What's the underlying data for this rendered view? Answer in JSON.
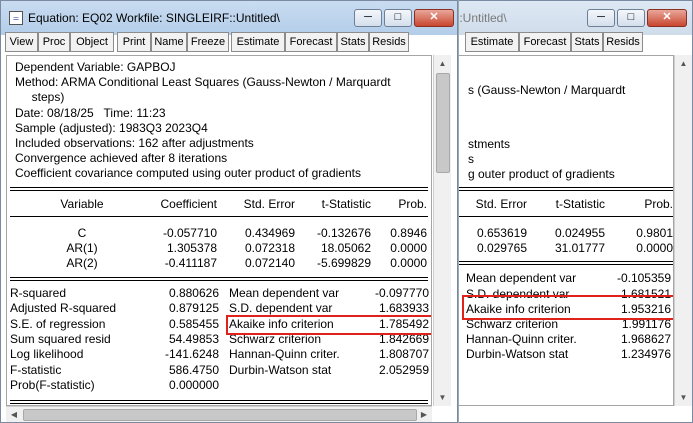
{
  "colors": {
    "highlight": "#e0221b",
    "titlebar": "#b9d1ea"
  },
  "window_a": {
    "title": "Equation: EQ02   Workfile: SINGLEIRF::Untitled\\",
    "toolbar": [
      "View",
      "Proc",
      "Object",
      "Print",
      "Name",
      "Freeze",
      "Estimate",
      "Forecast",
      "Stats",
      "Resids"
    ],
    "header_lines": [
      "Dependent Variable: GAPBOJ",
      "Method: ARMA Conditional Least Squares (Gauss-Newton / Marquardt",
      "     steps)",
      "Date: 08/18/25   Time: 11:23",
      "Sample (adjusted): 1983Q3 2023Q4",
      "Included observations: 162 after adjustments",
      "Convergence achieved after 8 iterations",
      "Coefficient covariance computed using outer product of gradients"
    ],
    "coef_headers": [
      "Variable",
      "Coefficient",
      "Std. Error",
      "t-Statistic",
      "Prob."
    ],
    "coef_rows": [
      [
        "C",
        "-0.057710",
        "0.434969",
        "-0.132676",
        "0.8946"
      ],
      [
        "AR(1)",
        "1.305378",
        "0.072318",
        "18.05062",
        "0.0000"
      ],
      [
        "AR(2)",
        "-0.411187",
        "0.072140",
        "-5.699829",
        "0.0000"
      ]
    ],
    "stats_rows": [
      [
        "R-squared",
        "0.880626",
        "Mean dependent var",
        "-0.097770"
      ],
      [
        "Adjusted R-squared",
        "0.879125",
        "S.D. dependent var",
        "1.683933"
      ],
      [
        "S.E. of regression",
        "0.585455",
        "Akaike info criterion",
        "1.785492"
      ],
      [
        "Sum squared resid",
        "54.49853",
        "Schwarz criterion",
        "1.842669"
      ],
      [
        "Log likelihood",
        "-141.6248",
        "Hannan-Quinn criter.",
        "1.808707"
      ],
      [
        "F-statistic",
        "586.4750",
        "Durbin-Watson stat",
        "2.052959"
      ],
      [
        "Prob(F-statistic)",
        "0.000000",
        "",
        ""
      ]
    ]
  },
  "window_b": {
    "title": "::Untitled\\",
    "toolbar": [
      "Estimate",
      "Forecast",
      "Stats",
      "Resids"
    ],
    "header_lines": [
      "",
      "s (Gauss-Newton / Marquardt",
      "",
      "",
      "",
      "stments",
      "s",
      "g outer product of gradients"
    ],
    "coef_headers": [
      "Std. Error",
      "t-Statistic",
      "Prob."
    ],
    "coef_rows": [
      [
        "0.653619",
        "0.024955",
        "0.9801"
      ],
      [
        "0.029765",
        "31.01777",
        "0.0000"
      ]
    ],
    "stats_rows": [
      [
        "Mean dependent var",
        "-0.105359"
      ],
      [
        "S.D. dependent var",
        "1.681521"
      ],
      [
        "Akaike info criterion",
        "1.953216"
      ],
      [
        "Schwarz criterion",
        "1.991176"
      ],
      [
        "Hannan-Quinn criter.",
        "1.968627"
      ],
      [
        "Durbin-Watson stat",
        "1.234976"
      ]
    ]
  }
}
